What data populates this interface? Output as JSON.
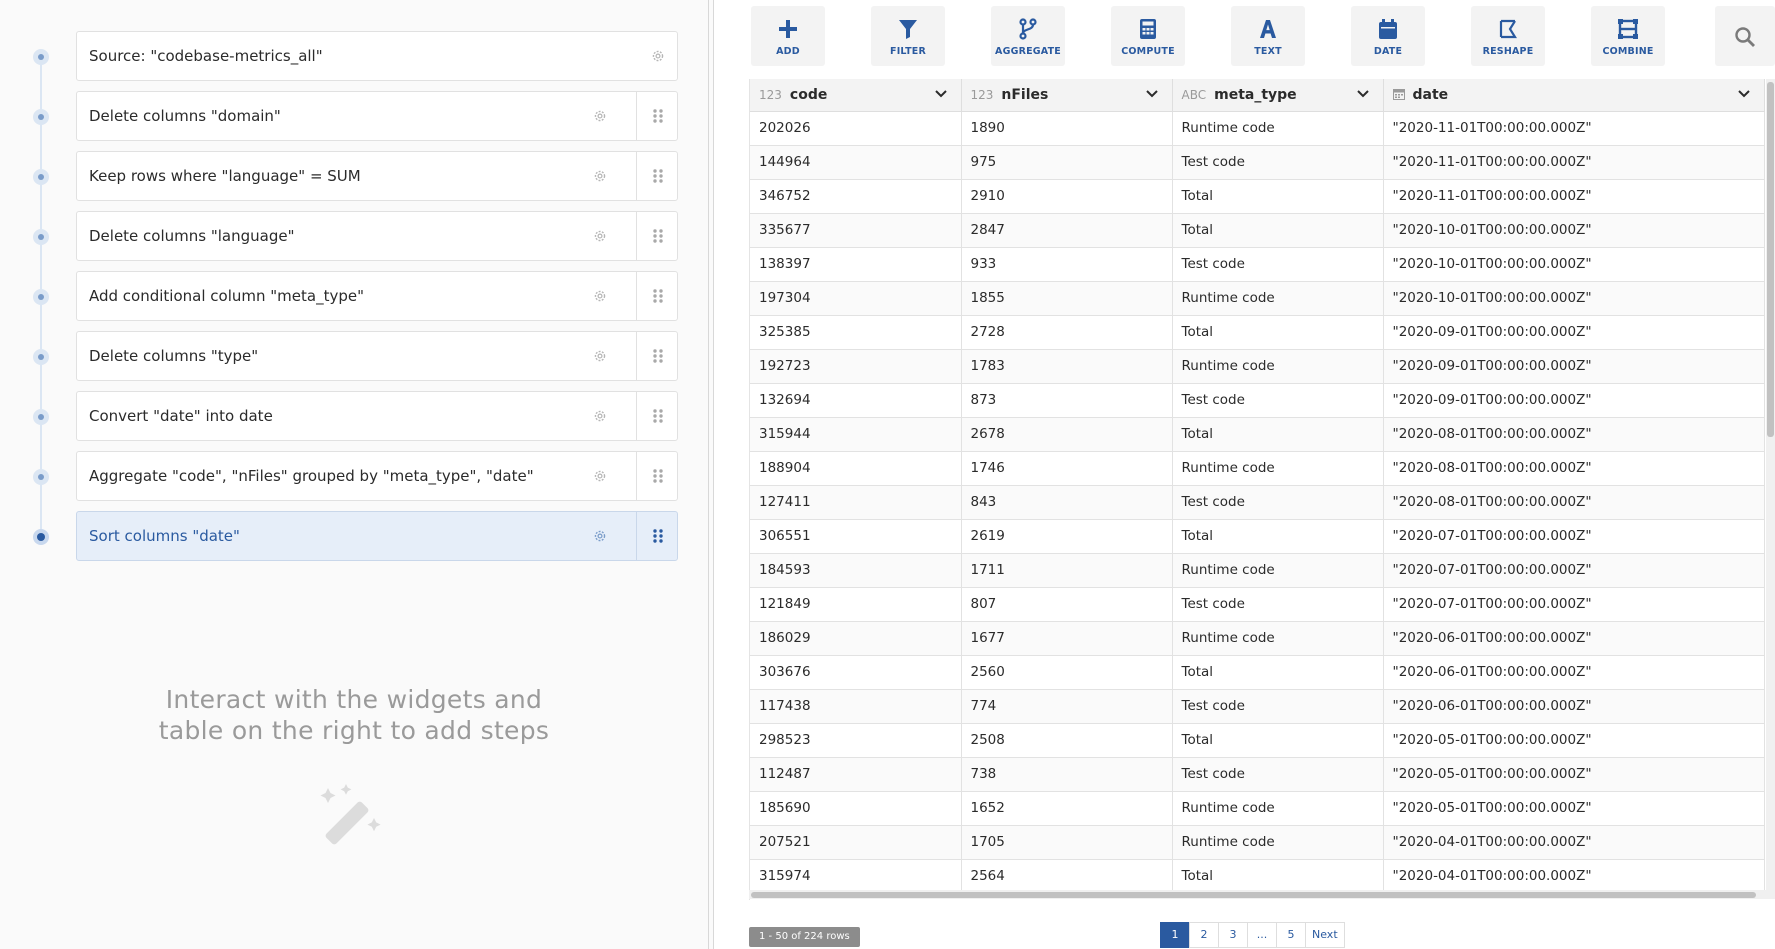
{
  "pipeline": {
    "steps": [
      {
        "label": "Source: \"codebase-metrics_all\""
      },
      {
        "label": "Delete columns \"domain\""
      },
      {
        "label": "Keep rows where \"language\" = SUM"
      },
      {
        "label": "Delete columns \"language\""
      },
      {
        "label": "Add conditional column \"meta_type\""
      },
      {
        "label": "Delete columns \"type\""
      },
      {
        "label": "Convert \"date\" into date"
      },
      {
        "label": "Aggregate \"code\", \"nFiles\" grouped by \"meta_type\", \"date\""
      },
      {
        "label": "Sort columns \"date\""
      }
    ],
    "hint_line1": "Interact with the widgets and",
    "hint_line2": "table on the right to add steps"
  },
  "toolbar": {
    "add": "ADD",
    "filter": "FILTER",
    "aggregate": "AGGREGATE",
    "compute": "COMPUTE",
    "text": "TEXT",
    "date": "DATE",
    "reshape": "RESHAPE",
    "combine": "COMBINE"
  },
  "table": {
    "columns": [
      {
        "type": "123",
        "name": "code"
      },
      {
        "type": "123",
        "name": "nFiles"
      },
      {
        "type": "ABC",
        "name": "meta_type"
      },
      {
        "type": "calendar-icon",
        "name": "date"
      }
    ],
    "rows": [
      [
        "202026",
        "1890",
        "Runtime code",
        "\"2020-11-01T00:00:00.000Z\""
      ],
      [
        "144964",
        "975",
        "Test code",
        "\"2020-11-01T00:00:00.000Z\""
      ],
      [
        "346752",
        "2910",
        "Total",
        "\"2020-11-01T00:00:00.000Z\""
      ],
      [
        "335677",
        "2847",
        "Total",
        "\"2020-10-01T00:00:00.000Z\""
      ],
      [
        "138397",
        "933",
        "Test code",
        "\"2020-10-01T00:00:00.000Z\""
      ],
      [
        "197304",
        "1855",
        "Runtime code",
        "\"2020-10-01T00:00:00.000Z\""
      ],
      [
        "325385",
        "2728",
        "Total",
        "\"2020-09-01T00:00:00.000Z\""
      ],
      [
        "192723",
        "1783",
        "Runtime code",
        "\"2020-09-01T00:00:00.000Z\""
      ],
      [
        "132694",
        "873",
        "Test code",
        "\"2020-09-01T00:00:00.000Z\""
      ],
      [
        "315944",
        "2678",
        "Total",
        "\"2020-08-01T00:00:00.000Z\""
      ],
      [
        "188904",
        "1746",
        "Runtime code",
        "\"2020-08-01T00:00:00.000Z\""
      ],
      [
        "127411",
        "843",
        "Test code",
        "\"2020-08-01T00:00:00.000Z\""
      ],
      [
        "306551",
        "2619",
        "Total",
        "\"2020-07-01T00:00:00.000Z\""
      ],
      [
        "184593",
        "1711",
        "Runtime code",
        "\"2020-07-01T00:00:00.000Z\""
      ],
      [
        "121849",
        "807",
        "Test code",
        "\"2020-07-01T00:00:00.000Z\""
      ],
      [
        "186029",
        "1677",
        "Runtime code",
        "\"2020-06-01T00:00:00.000Z\""
      ],
      [
        "303676",
        "2560",
        "Total",
        "\"2020-06-01T00:00:00.000Z\""
      ],
      [
        "117438",
        "774",
        "Test code",
        "\"2020-06-01T00:00:00.000Z\""
      ],
      [
        "298523",
        "2508",
        "Total",
        "\"2020-05-01T00:00:00.000Z\""
      ],
      [
        "112487",
        "738",
        "Test code",
        "\"2020-05-01T00:00:00.000Z\""
      ],
      [
        "185690",
        "1652",
        "Runtime code",
        "\"2020-05-01T00:00:00.000Z\""
      ],
      [
        "207521",
        "1705",
        "Runtime code",
        "\"2020-04-01T00:00:00.000Z\""
      ],
      [
        "315974",
        "2564",
        "Total",
        "\"2020-04-01T00:00:00.000Z\""
      ]
    ]
  },
  "footer": {
    "row_count": "1 - 50 of 224 rows",
    "pages": [
      "1",
      "2",
      "3",
      "...",
      "5",
      "Next"
    ]
  },
  "colors": {
    "accent": "#2a5aa0",
    "active_step_bg": "#e6eef9"
  }
}
